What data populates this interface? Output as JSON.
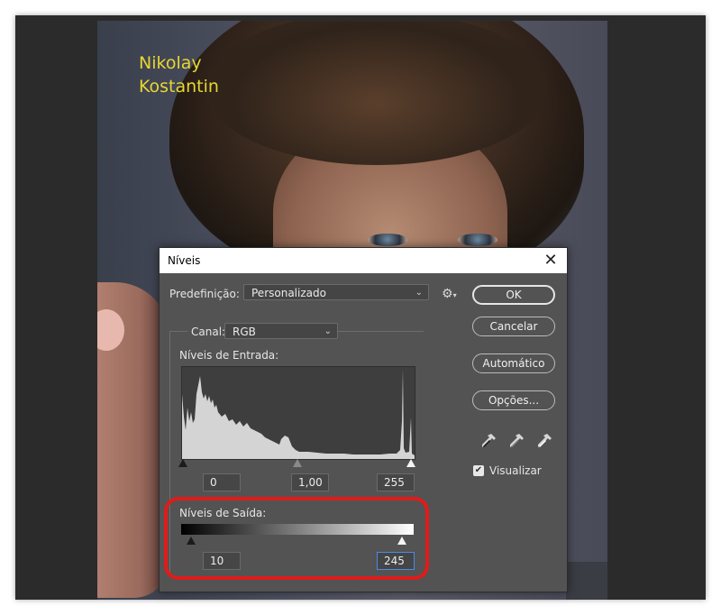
{
  "photo": {
    "author_line1": "Nikolay",
    "author_line2": "Kostantin"
  },
  "dialog": {
    "title": "Níveis",
    "preset_label": "Predefinição:",
    "preset_value": "Personalizado",
    "channel_label": "Canal:",
    "channel_value": "RGB",
    "input_levels_label": "Níveis de Entrada:",
    "input_black": "0",
    "input_gamma": "1,00",
    "input_white": "255",
    "output_levels_label": "Níveis de Saída:",
    "output_black": "10",
    "output_white": "245",
    "buttons": {
      "ok": "OK",
      "cancel": "Cancelar",
      "auto": "Automático",
      "options": "Opções..."
    },
    "preview_label": "Visualizar",
    "preview_checked": true
  },
  "icons": {
    "close": "close-icon",
    "gear": "gear-icon",
    "eyedropper_black": "eyedropper-black-icon",
    "eyedropper_gray": "eyedropper-gray-icon",
    "eyedropper_white": "eyedropper-white-icon"
  },
  "colors": {
    "dialog_bg": "#535353",
    "highlight": "#e01b1b",
    "author_text": "#e8d632"
  }
}
